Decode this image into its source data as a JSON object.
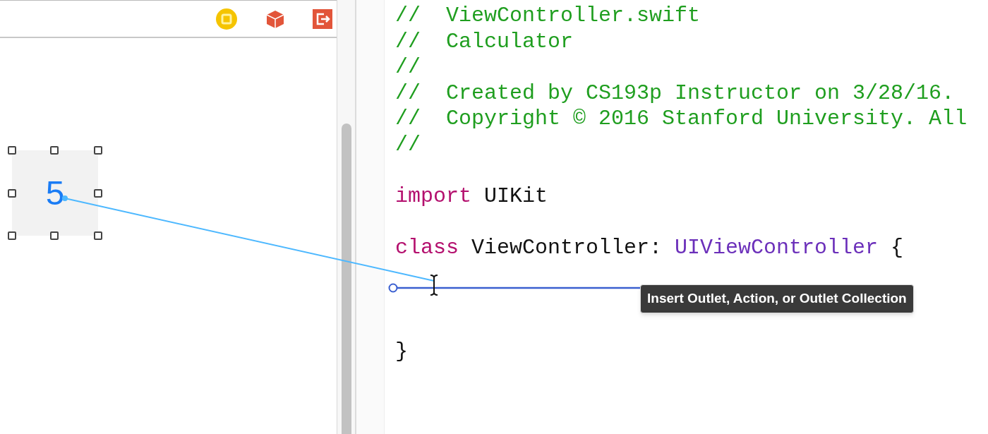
{
  "canvas": {
    "label": {
      "text": "5",
      "selected": true
    }
  },
  "editor": {
    "lines": [
      {
        "kind": "code",
        "tokens": [
          {
            "kind": "comment",
            "text": "//  ViewController.swift"
          }
        ]
      },
      {
        "kind": "code",
        "tokens": [
          {
            "kind": "comment",
            "text": "//  Calculator"
          }
        ]
      },
      {
        "kind": "code",
        "tokens": [
          {
            "kind": "comment",
            "text": "//"
          }
        ]
      },
      {
        "kind": "code",
        "tokens": [
          {
            "kind": "comment",
            "text": "//  Created by CS193p Instructor on 3/28/16."
          }
        ]
      },
      {
        "kind": "code",
        "tokens": [
          {
            "kind": "comment",
            "text": "//  Copyright © 2016 Stanford University. All"
          }
        ]
      },
      {
        "kind": "code",
        "tokens": [
          {
            "kind": "comment",
            "text": "//"
          }
        ]
      },
      {
        "kind": "blank"
      },
      {
        "kind": "code",
        "tokens": [
          {
            "kind": "keyword",
            "text": "import"
          },
          {
            "kind": "plain",
            "text": "UIKit"
          }
        ]
      },
      {
        "kind": "blank"
      },
      {
        "kind": "code",
        "tokens": [
          {
            "kind": "keyword",
            "text": "class"
          },
          {
            "kind": "plain",
            "text": "ViewController:"
          },
          {
            "kind": "type",
            "text": "UIViewController"
          },
          {
            "kind": "plain",
            "text": "{"
          }
        ]
      },
      {
        "kind": "blank"
      },
      {
        "kind": "blank"
      },
      {
        "kind": "blank"
      },
      {
        "kind": "code",
        "tokens": [
          {
            "kind": "plain",
            "text": "}"
          }
        ]
      }
    ]
  },
  "tooltip": "Insert Outlet, Action, or Outlet Collection"
}
